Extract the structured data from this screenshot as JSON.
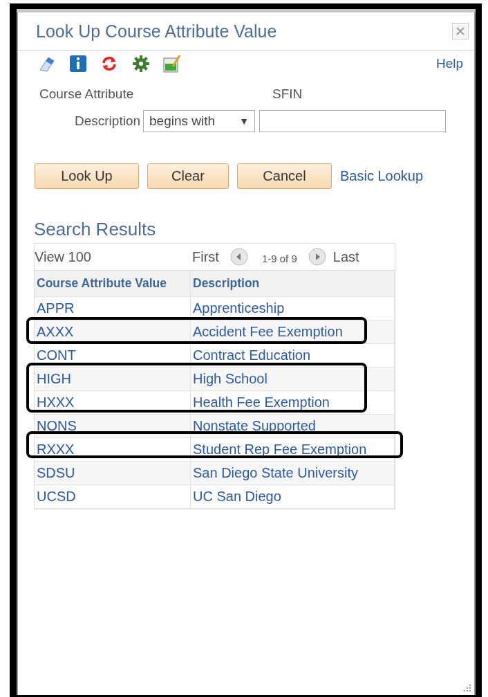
{
  "dialog": {
    "title": "Look Up Course Attribute Value",
    "help_link": "Help"
  },
  "criteria": {
    "course_attribute_label": "Course Attribute",
    "course_attribute_value": "SFIN",
    "description_label": "Description",
    "operator": "begins with",
    "operator_arrow": "▼"
  },
  "buttons": [
    "Look Up",
    "Clear",
    "Cancel"
  ],
  "basic_lookup_link": "Basic Lookup",
  "results": {
    "title": "Search Results",
    "view": "View 100",
    "first": "First",
    "range": "1-9 of 9",
    "last": "Last",
    "columns": [
      "Course Attribute Value",
      "Description"
    ],
    "rows": [
      {
        "value": "APPR",
        "description": "Apprenticeship",
        "highlighted": false
      },
      {
        "value": "AXXX",
        "description": "Accident Fee Exemption",
        "highlighted": true
      },
      {
        "value": "CONT",
        "description": "Contract Education",
        "highlighted": false
      },
      {
        "value": "HIGH",
        "description": "High School",
        "highlighted": true
      },
      {
        "value": "HXXX",
        "description": "Health Fee Exemption",
        "highlighted": true
      },
      {
        "value": "NONS",
        "description": "Nonstate Supported",
        "highlighted": false
      },
      {
        "value": "RXXX",
        "description": "Student Rep Fee Exemption",
        "highlighted": true
      },
      {
        "value": "SDSU",
        "description": "San Diego State University",
        "highlighted": false
      },
      {
        "value": "UCSD",
        "description": "UC San Diego",
        "highlighted": false
      }
    ]
  }
}
